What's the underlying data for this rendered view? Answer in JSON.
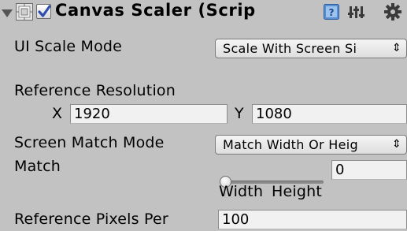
{
  "component": {
    "title": "Canvas Scaler (Scrip",
    "enabled": true,
    "icons": [
      "foldout-arrow-icon",
      "canvas-scaler-icon",
      "help-icon",
      "presets-icon",
      "gear-icon"
    ]
  },
  "ui_scale_mode": {
    "label": "UI Scale Mode",
    "value": "Scale With Screen Si"
  },
  "reference_resolution": {
    "label": "Reference Resolution",
    "x_label": "X",
    "x_value": "1920",
    "y_label": "Y",
    "y_value": "1080"
  },
  "screen_match_mode": {
    "label": "Screen Match Mode",
    "value": "Match Width Or Heig"
  },
  "match": {
    "label": "Match",
    "slider_fraction": 0,
    "value": "0",
    "left_caption": "Width",
    "right_caption": "Height"
  },
  "reference_pixels_per_unit": {
    "label": "Reference Pixels Per",
    "value": "100"
  },
  "colors": {
    "background": "#c2c2c2",
    "checkbox_check": "#2f4fb0",
    "help_icon": "#5a8fd0"
  }
}
